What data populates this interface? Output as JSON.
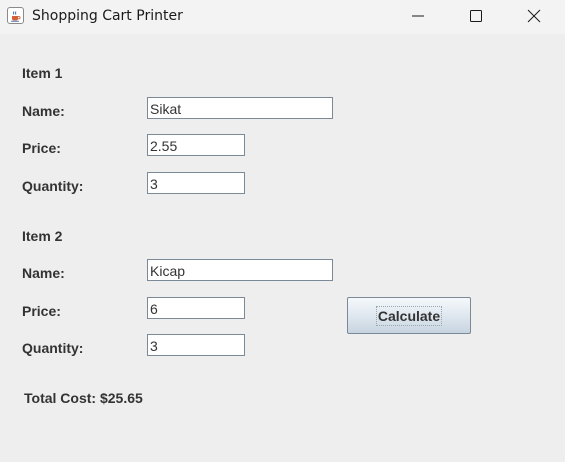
{
  "window": {
    "title": "Shopping Cart Printer",
    "app_icon": "java-cup-icon",
    "controls": [
      "minimize-icon",
      "maximize-icon",
      "close-icon"
    ]
  },
  "item1": {
    "heading": "Item 1",
    "name_label": "Name:",
    "name_value": "Sikat",
    "price_label": "Price:",
    "price_value": "2.55",
    "quantity_label": "Quantity:",
    "quantity_value": "3"
  },
  "item2": {
    "heading": "Item 2",
    "name_label": "Name:",
    "name_value": "Kicap",
    "price_label": "Price:",
    "price_value": "6",
    "quantity_label": "Quantity:",
    "quantity_value": "3"
  },
  "actions": {
    "calculate_label": "Calculate"
  },
  "result": {
    "total_text": "Total Cost: $25.65"
  },
  "colors": {
    "window_bg": "#eeeeee",
    "titlebar_bg": "#f3f3f3",
    "field_border": "#7a8a99",
    "label_text": "#333333"
  }
}
